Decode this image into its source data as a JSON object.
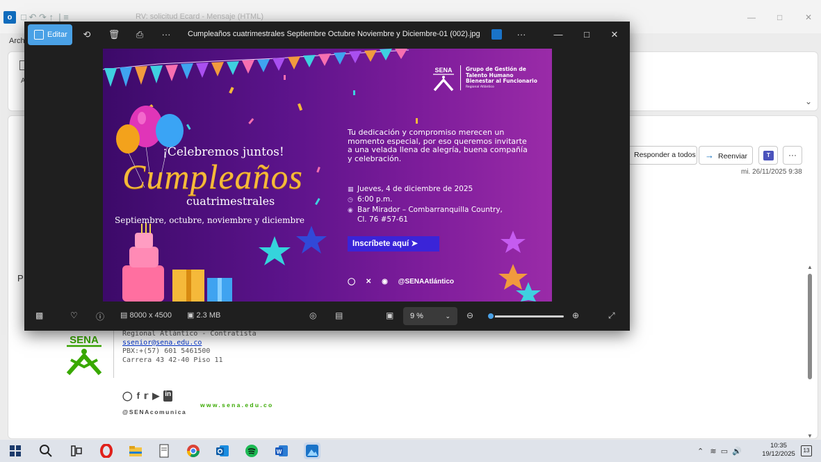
{
  "outlook": {
    "title": "RV: solicitud Ecard - Mensaje (HTML)",
    "arch_label": "Arch",
    "ribbon_letter": "A",
    "reply_all_label": "Responder a todos",
    "forward_label": "Reenviar",
    "more_label": "···",
    "date": "mi. 26/11/2025 9:38",
    "p_letter": "P"
  },
  "signature": {
    "logo_text": "SENA",
    "line1": "Regional Atlántico - Contratista",
    "email": "ssenior@sena.edu.co",
    "phone": "PBX:+(57) 601 5461500",
    "address": "Carrera 43 42-40 Piso 11",
    "website": "www.sena.edu.co",
    "handle": "@SENAcomunica"
  },
  "viewer": {
    "edit_label": "Editar",
    "filename": "Cumpleaños cuatrimestrales Septiembre Octubre Noviembre y Diciembre-01 (002).jpg",
    "dimensions": "8000 x 4500",
    "filesize": "2.3 MB",
    "zoom": "9 %",
    "zoom_fraction": 0.03
  },
  "photo": {
    "org_lines": [
      "Grupo de Gestión de",
      "Talento Humano",
      "Bienestar al Funcionario"
    ],
    "org_small": "Regional Atlántico",
    "sena_text": "SENA",
    "headline": "¡Celebremos juntos!",
    "script": "Cumpleaños",
    "subscript": "cuatrimestrales",
    "months": "Septiembre, octubre, noviembre y diciembre",
    "paragraph": "Tu dedicación y compromiso merecen un momento especial, por eso queremos invitarte a una velada llena de alegría, buena compañía y celebración.",
    "date": "Jueves, 4 de diciembre de 2025",
    "time": "6:00 p.m.",
    "place_line1": "Bar Mirador – Combarranquilla Country,",
    "place_line2": "Cl. 76 #57-61",
    "cta": "Inscríbete aquí",
    "social_handle": "@SENAAtlántico"
  },
  "taskbar": {
    "time": "10:35",
    "date": "19/12/2025",
    "notifications": "13"
  }
}
